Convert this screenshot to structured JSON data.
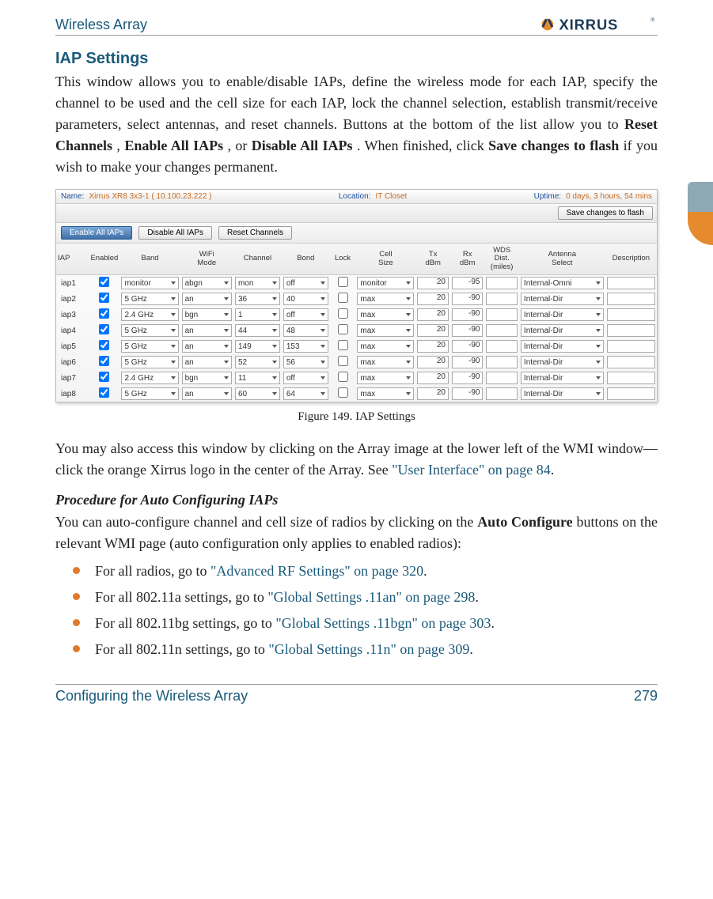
{
  "header": {
    "title": "Wireless Array",
    "logo_text": "XIRRUS"
  },
  "side_tab": {
    "present": true
  },
  "section_heading": "IAP Settings",
  "para1": {
    "t1": "This window allows you to enable/disable IAPs, define the wireless mode for each IAP, specify the channel to be used and the cell size for each IAP, lock the channel selection, establish transmit/receive parameters, select antennas, and reset channels. Buttons at the bottom of the list allow you to ",
    "b1": "Reset Channels",
    "t2": ", ",
    "b2": "Enable All IAPs",
    "t3": ", or ",
    "b3": "Disable All IAPs",
    "t4": ". When finished, click ",
    "b4": "Save changes to flash",
    "t5": " if you wish to make your changes permanent."
  },
  "screenshot": {
    "topbar": {
      "name_label": "Name:",
      "name_value": "Xirrus XR8 3x3-1   ( 10.100.23.222 )",
      "location_label": "Location:",
      "location_value": "IT Closet",
      "uptime_label": "Uptime:",
      "uptime_value": "0 days, 3 hours, 54 mins"
    },
    "save_button": "Save changes to flash",
    "buttons": {
      "enable_all": "Enable All IAPs",
      "disable_all": "Disable All IAPs",
      "reset_channels": "Reset Channels"
    },
    "columns": [
      "IAP",
      "Enabled",
      "Band",
      "WiFi Mode",
      "Channel",
      "Bond",
      "Lock",
      "Cell Size",
      "Tx dBm",
      "Rx dBm",
      "WDS Dist. (miles)",
      "Antenna Select",
      "Description"
    ],
    "rows": [
      {
        "iap": "iap1",
        "enabled": true,
        "band": "monitor",
        "wifi": "abgn",
        "channel": "mon",
        "bond": "off",
        "lock": false,
        "cell": "monitor",
        "tx": "20",
        "rx": "-95",
        "wds": "",
        "antenna": "Internal-Omni",
        "desc": ""
      },
      {
        "iap": "iap2",
        "enabled": true,
        "band": "5 GHz",
        "wifi": "an",
        "channel": "36",
        "bond": "40",
        "lock": false,
        "cell": "max",
        "tx": "20",
        "rx": "-90",
        "wds": "",
        "antenna": "Internal-Dir",
        "desc": ""
      },
      {
        "iap": "iap3",
        "enabled": true,
        "band": "2.4 GHz",
        "wifi": "bgn",
        "channel": "1",
        "bond": "off",
        "lock": false,
        "cell": "max",
        "tx": "20",
        "rx": "-90",
        "wds": "",
        "antenna": "Internal-Dir",
        "desc": ""
      },
      {
        "iap": "iap4",
        "enabled": true,
        "band": "5 GHz",
        "wifi": "an",
        "channel": "44",
        "bond": "48",
        "lock": false,
        "cell": "max",
        "tx": "20",
        "rx": "-90",
        "wds": "",
        "antenna": "Internal-Dir",
        "desc": ""
      },
      {
        "iap": "iap5",
        "enabled": true,
        "band": "5 GHz",
        "wifi": "an",
        "channel": "149",
        "bond": "153",
        "lock": false,
        "cell": "max",
        "tx": "20",
        "rx": "-90",
        "wds": "",
        "antenna": "Internal-Dir",
        "desc": ""
      },
      {
        "iap": "iap6",
        "enabled": true,
        "band": "5 GHz",
        "wifi": "an",
        "channel": "52",
        "bond": "56",
        "lock": false,
        "cell": "max",
        "tx": "20",
        "rx": "-90",
        "wds": "",
        "antenna": "Internal-Dir",
        "desc": ""
      },
      {
        "iap": "iap7",
        "enabled": true,
        "band": "2.4 GHz",
        "wifi": "bgn",
        "channel": "11",
        "bond": "off",
        "lock": false,
        "cell": "max",
        "tx": "20",
        "rx": "-90",
        "wds": "",
        "antenna": "Internal-Dir",
        "desc": ""
      },
      {
        "iap": "iap8",
        "enabled": true,
        "band": "5 GHz",
        "wifi": "an",
        "channel": "60",
        "bond": "64",
        "lock": false,
        "cell": "max",
        "tx": "20",
        "rx": "-90",
        "wds": "",
        "antenna": "Internal-Dir",
        "desc": ""
      }
    ]
  },
  "figure_caption": "Figure 149. IAP Settings",
  "para2": {
    "t1": "You may also access this window by clicking on the Array image at the lower left of the WMI window—click the orange Xirrus logo in the center of the Array. See ",
    "link": "\"User Interface\" on page 84",
    "t2": "."
  },
  "sub_heading": "Procedure for Auto Configuring IAPs",
  "para3": {
    "t1": "You can auto-configure channel and cell size of radios by clicking on the ",
    "b1": "Auto Configure",
    "t2": " buttons on the relevant WMI page (auto configuration only applies to enabled radios):"
  },
  "bullets": [
    {
      "pre": "For all radios, go to ",
      "link": "\"Advanced RF Settings\" on page 320",
      "post": "."
    },
    {
      "pre": "For all 802.11a settings, go to ",
      "link": "\"Global Settings .11an\" on page 298",
      "post": "."
    },
    {
      "pre": "For all 802.11bg settings, go to ",
      "link": "\"Global Settings .11bgn\" on page 303",
      "post": "."
    },
    {
      "pre": "For all 802.11n settings, go to ",
      "link": "\"Global Settings .11n\" on page 309",
      "post": "."
    }
  ],
  "footer": {
    "left": "Configuring the Wireless Array",
    "right": "279"
  }
}
